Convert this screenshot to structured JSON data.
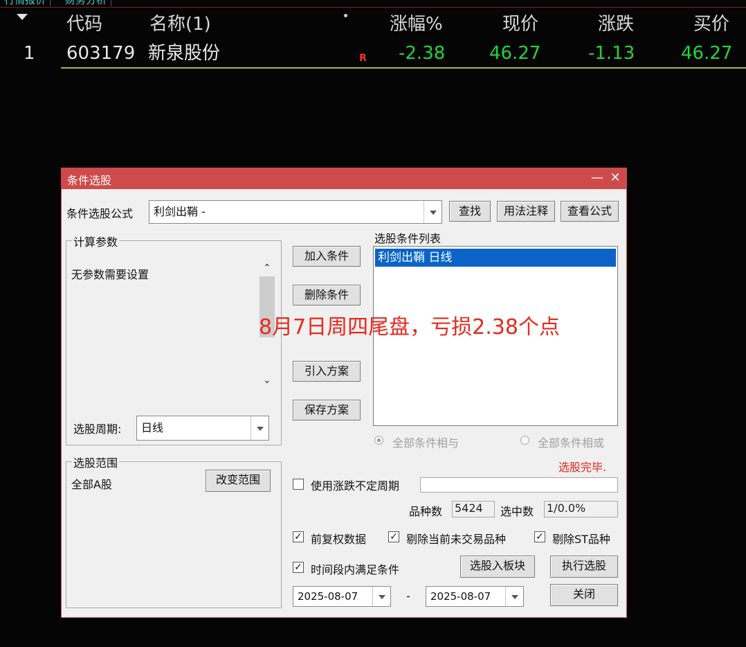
{
  "top_tabs": [
    "行情报价",
    "财务分析"
  ],
  "table": {
    "headers": [
      "代码",
      "名称(1)",
      "涨幅%",
      "现价",
      "涨跌",
      "买价"
    ],
    "rows": [
      {
        "index": "1",
        "code": "603179",
        "name": "新泉股份",
        "badge": "R",
        "change_pct": "-2.38",
        "price": "46.27",
        "change": "-1.13",
        "bid": "46.27"
      }
    ]
  },
  "dialog": {
    "title": "条件选股",
    "formula_label": "条件选股公式",
    "formula_value": "利剑出鞘 -",
    "btn_find": "查找",
    "btn_usage": "用法注释",
    "btn_view": "查看公式",
    "params_group": "计算参数",
    "params_text": "无参数需要设置",
    "period_label": "选股周期:",
    "period_value": "日线",
    "btn_add": "加入条件",
    "btn_delete": "删除条件",
    "btn_import": "引入方案",
    "btn_save": "保存方案",
    "list_title": "选股条件列表",
    "list_items": [
      "利剑出鞘 日线"
    ],
    "radio_and": "全部条件相与",
    "radio_or": "全部条件相或",
    "status": "选股完毕.",
    "range_group": "选股范围",
    "range_value": "全部A股",
    "btn_change_range": "改变范围",
    "use_period_label": "使用涨跌不定周期",
    "count_label": "品种数",
    "count_value": "5424",
    "selected_label": "选中数",
    "selected_value": "1/0.0%",
    "chk_fq": "前复权数据",
    "chk_exclude_untraded": "剔除当前未交易品种",
    "chk_exclude_st": "剔除ST品种",
    "chk_period_satisfy": "时间段内满足条件",
    "btn_to_block": "选股入板块",
    "btn_execute": "执行选股",
    "btn_close": "关闭",
    "date_from": "2025-08-07",
    "date_sep": "-",
    "date_to": "2025-08-07"
  },
  "annotation": "8月7日周四尾盘，亏损2.38个点",
  "colors": {
    "up_down_green": "#22d43a",
    "dialog_title": "#cf4a4a",
    "selection": "#0a64c8",
    "annotation": "#e8281e"
  }
}
